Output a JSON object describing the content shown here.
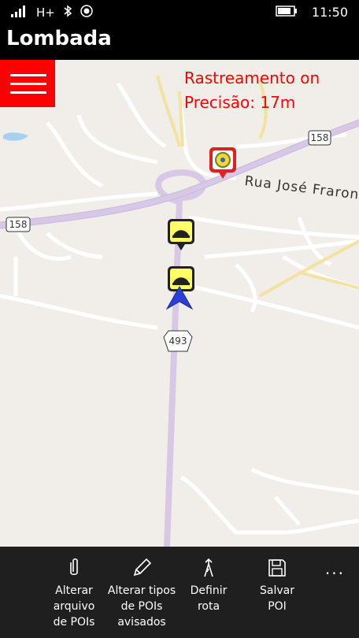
{
  "status_bar": {
    "network": "H+",
    "time": "11:50"
  },
  "app": {
    "title": "Lombada"
  },
  "overlay": {
    "tracking": "Rastreamento on",
    "precision": "Precisão: 17m"
  },
  "map": {
    "street_label": "Rua José Fraron",
    "route_shield_a": "158",
    "route_shield_b": "158",
    "route_shield_c": "493"
  },
  "app_bar": {
    "buttons": [
      {
        "label": "Alterar\narquivo\nde POIs",
        "icon": "paperclip-icon"
      },
      {
        "label": "Alterar tipos\nde POIs\navisados",
        "icon": "pencil-icon"
      },
      {
        "label": "Definir\nrota",
        "icon": "route-icon"
      },
      {
        "label": "Salvar\nPOI",
        "icon": "save-icon"
      }
    ],
    "more": "..."
  },
  "colors": {
    "accent": "#ff0000",
    "speed_bump_marker": "#ffff66",
    "road_main": "#d7c9e6",
    "road_local": "#f6e8a8",
    "map_bg": "#f1eeea",
    "appbar_bg": "#1f1f1f"
  }
}
